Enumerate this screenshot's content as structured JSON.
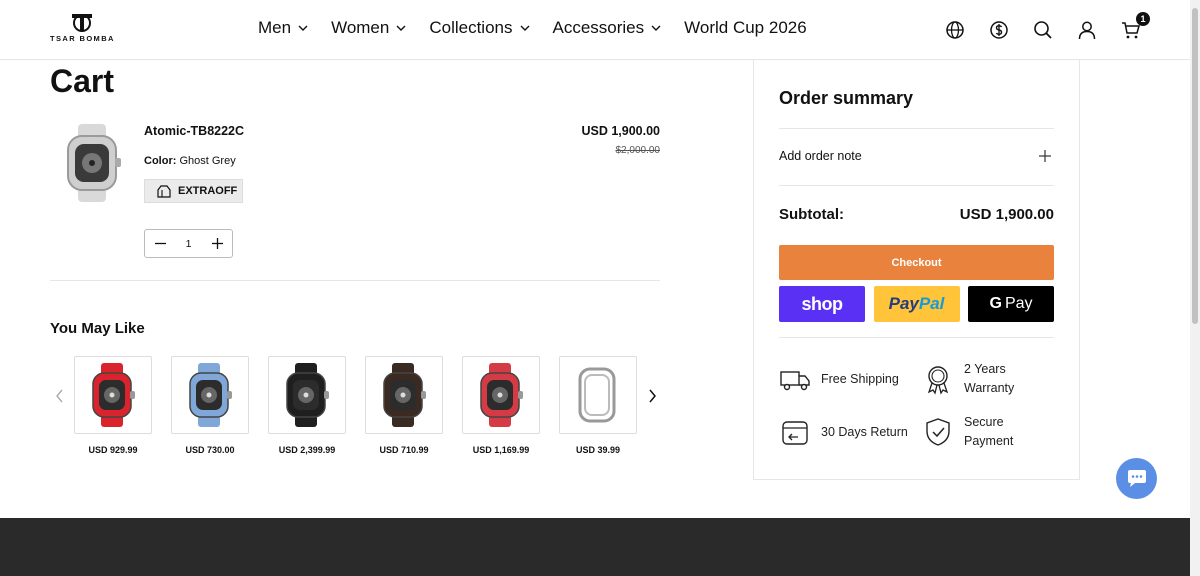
{
  "brand": {
    "name": "TSAR BOMBA"
  },
  "nav": {
    "items": [
      {
        "label": "Men",
        "has_dropdown": true
      },
      {
        "label": "Women",
        "has_dropdown": true
      },
      {
        "label": "Collections",
        "has_dropdown": true
      },
      {
        "label": "Accessories",
        "has_dropdown": true
      },
      {
        "label": "World Cup 2026",
        "has_dropdown": false
      }
    ]
  },
  "header_icons": [
    "globe-icon",
    "currency-icon",
    "search-icon",
    "account-icon",
    "cart-icon"
  ],
  "cart_count": "1",
  "cart": {
    "title": "Cart",
    "item": {
      "name": "Atomic-TB8222C",
      "color_label": "Color:",
      "color_value": "Ghost Grey",
      "coupon": "EXTRAOFF",
      "price": "USD 1,900.00",
      "compare_price": "$2,000.00",
      "quantity": "1"
    }
  },
  "you_may_like": {
    "title": "You May Like",
    "products": [
      {
        "price": "USD 929.99",
        "color": "#d9232d"
      },
      {
        "price": "USD 730.00",
        "color": "#7fa8d8"
      },
      {
        "price": "USD 2,399.99",
        "color": "#1f1f1f"
      },
      {
        "price": "USD 710.99",
        "color": "#3a2a22"
      },
      {
        "price": "USD 1,169.99",
        "color": "#d43b45"
      },
      {
        "price": "USD 39.99",
        "color": "#e9e9e9"
      }
    ]
  },
  "summary": {
    "title": "Order summary",
    "add_note": "Add order note",
    "subtotal_label": "Subtotal:",
    "subtotal_value": "USD 1,900.00",
    "checkout_label": "Checkout",
    "shop_label": "shop",
    "paypal_label_1": "Pay",
    "paypal_label_2": "Pal",
    "gpay_g": "G",
    "gpay_label": "Pay",
    "features": [
      {
        "line1": "Free Shipping",
        "line2": ""
      },
      {
        "line1": "2 Years",
        "line2": "Warranty"
      },
      {
        "line1": "30 Days Return",
        "line2": ""
      },
      {
        "line1": "Secure",
        "line2": "Payment"
      }
    ]
  },
  "colors": {
    "checkout": "#e8823d",
    "shop_pay": "#5a31f4",
    "paypal": "#ffc439",
    "gpay": "#000000",
    "chat": "#5b8fe6",
    "footer": "#2a2a2a"
  }
}
